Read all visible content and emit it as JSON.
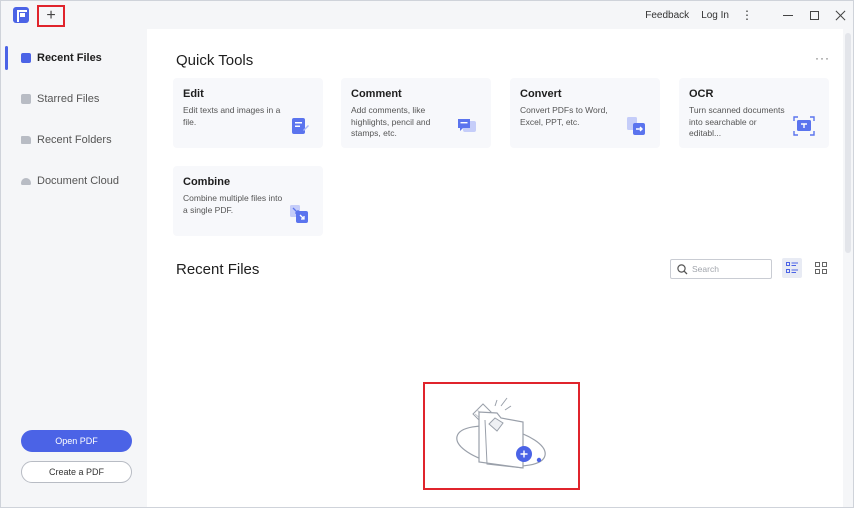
{
  "titlebar": {
    "new_tab": "+",
    "feedback": "Feedback",
    "login": "Log In",
    "more": "⋮"
  },
  "sidebar": {
    "items": [
      {
        "label": "Recent Files",
        "icon": "recent-files-icon",
        "active": true
      },
      {
        "label": "Starred Files",
        "icon": "star-icon"
      },
      {
        "label": "Recent Folders",
        "icon": "folder-icon"
      },
      {
        "label": "Document Cloud",
        "icon": "cloud-icon"
      }
    ],
    "open_pdf": "Open PDF",
    "create_pdf": "Create a PDF"
  },
  "quick_tools": {
    "title": "Quick Tools",
    "more": "···",
    "tools": [
      {
        "name": "Edit",
        "desc": "Edit texts and images in a file."
      },
      {
        "name": "Comment",
        "desc": "Add comments, like highlights, pencil and stamps, etc."
      },
      {
        "name": "Convert",
        "desc": "Convert PDFs to Word, Excel, PPT, etc."
      },
      {
        "name": "OCR",
        "desc": "Turn scanned documents into searchable or editabl..."
      },
      {
        "name": "Combine",
        "desc": "Combine multiple files into a single PDF."
      }
    ]
  },
  "recent": {
    "title": "Recent Files",
    "search_placeholder": "Search"
  },
  "colors": {
    "accent": "#4b63e6",
    "highlight": "#e0242c"
  }
}
